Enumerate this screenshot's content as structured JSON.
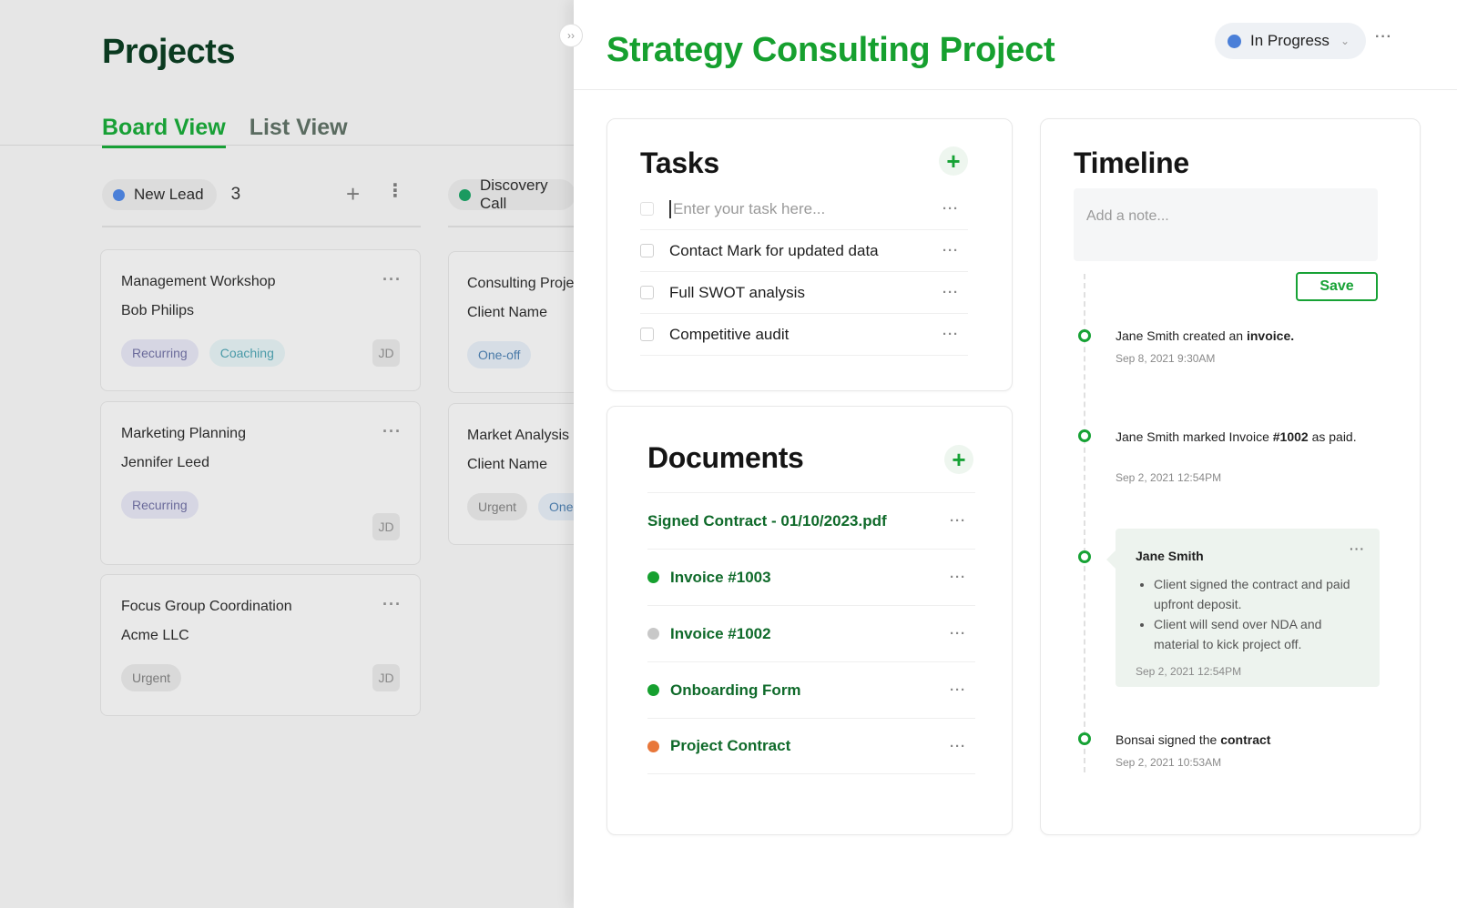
{
  "board": {
    "title": "Projects",
    "tabs": [
      {
        "label": "Board View",
        "active": true
      },
      {
        "label": "List View",
        "active": false
      }
    ],
    "columns": [
      {
        "name": "New Lead",
        "count": "3",
        "color": "#4a7fd8"
      },
      {
        "name": "Discovery Call",
        "color": "#1a9a60"
      }
    ],
    "cards_col1": [
      {
        "title": "Management Workshop",
        "client": "Bob Philips",
        "tags": [
          "Recurring",
          "Coaching"
        ],
        "assignee": "JD"
      },
      {
        "title": "Marketing Planning",
        "client": "Jennifer Leed",
        "tags": [
          "Recurring"
        ],
        "assignee": "JD"
      },
      {
        "title": "Focus Group Coordination",
        "client": "Acme LLC",
        "tags": [
          "Urgent"
        ],
        "assignee": "JD"
      }
    ],
    "cards_col2": [
      {
        "title": "Consulting Project",
        "client": "Client Name",
        "tags": [
          "One-off"
        ]
      },
      {
        "title": "Market Analysis",
        "client": "Client Name",
        "tags": [
          "Urgent",
          "One-off"
        ]
      }
    ]
  },
  "panel": {
    "title": "Strategy Consulting Project",
    "status": {
      "label": "In Progress",
      "color": "#4a7fd8"
    },
    "more": "···"
  },
  "tasks": {
    "title": "Tasks",
    "add": "+",
    "input_placeholder": "Enter your task here...",
    "items": [
      {
        "label": "Contact Mark for updated data"
      },
      {
        "label": "Full SWOT analysis"
      },
      {
        "label": "Competitive audit"
      }
    ]
  },
  "documents": {
    "title": "Documents",
    "add": "+",
    "items": [
      {
        "label": "Signed Contract - 01/10/2023.pdf",
        "dot": null
      },
      {
        "label": "Invoice #1003",
        "dot": "#16a02f"
      },
      {
        "label": "Invoice #1002",
        "dot": "#c8c8c8"
      },
      {
        "label": "Onboarding Form",
        "dot": "#16a02f"
      },
      {
        "label": "Project Contract",
        "dot": "#e8773a"
      }
    ]
  },
  "timeline": {
    "title": "Timeline",
    "note_placeholder": "Add a note...",
    "save_label": "Save",
    "events": [
      {
        "actor": "Jane Smith created an",
        "object": "invoice.",
        "date": "Sep 8, 2021 9:30AM"
      },
      {
        "actor": "Jane Smith marked Invoice",
        "object": "#1002",
        "suffix": "as paid.",
        "date": "Sep 2, 2021 12:54PM"
      },
      {
        "actor": "Bonsai signed the",
        "object": "contract",
        "date": "Sep 2, 2021 10:53AM"
      }
    ],
    "note": {
      "author": "Jane Smith",
      "bullets": [
        "Client signed the contract and paid upfront deposit.",
        "Client will send over NDA and material to kick project off."
      ],
      "date": "Sep 2, 2021 12:54PM"
    }
  },
  "colors": {
    "accent": "#16a02f",
    "title_dark": "#0b3a20"
  }
}
